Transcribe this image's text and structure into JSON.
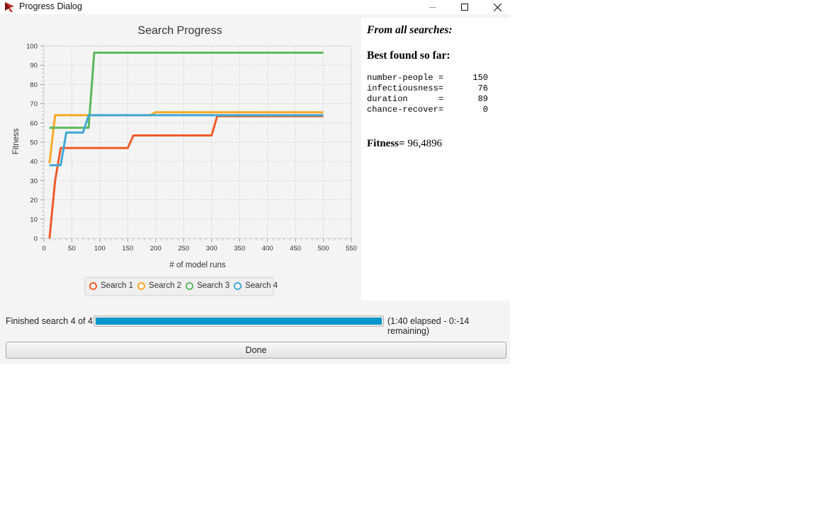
{
  "window": {
    "title": "Progress Dialog",
    "icon": "app-logo-icon",
    "controls": [
      "minimize-icon",
      "maximize-icon",
      "close-icon"
    ]
  },
  "chart_data": {
    "type": "line",
    "title": "Search Progress",
    "xlabel": "# of model runs",
    "ylabel": "Fitness",
    "xlim": [
      0,
      550
    ],
    "ylim": [
      0,
      100
    ],
    "xticks": [
      0,
      50,
      100,
      150,
      200,
      250,
      300,
      350,
      400,
      450,
      500,
      550
    ],
    "yticks": [
      0,
      10,
      20,
      30,
      40,
      50,
      60,
      70,
      80,
      90,
      100
    ],
    "grid": true,
    "legend": "bottom-center",
    "series": [
      {
        "name": "Search 1",
        "color": "#f05a28",
        "points": [
          [
            10,
            0
          ],
          [
            20,
            30
          ],
          [
            30,
            47
          ],
          [
            150,
            47
          ],
          [
            160,
            53.5
          ],
          [
            300,
            53.5
          ],
          [
            310,
            63.5
          ],
          [
            500,
            63.5
          ]
        ]
      },
      {
        "name": "Search 2",
        "color": "#f9a825",
        "points": [
          [
            10,
            39
          ],
          [
            20,
            64
          ],
          [
            190,
            64
          ],
          [
            200,
            65.5
          ],
          [
            500,
            65.5
          ]
        ]
      },
      {
        "name": "Search 3",
        "color": "#5cb85c",
        "points": [
          [
            10,
            57.5
          ],
          [
            80,
            57.5
          ],
          [
            90,
            96.5
          ],
          [
            500,
            96.5
          ]
        ]
      },
      {
        "name": "Search 4",
        "color": "#3fa9d6",
        "points": [
          [
            10,
            38
          ],
          [
            30,
            38
          ],
          [
            40,
            55
          ],
          [
            70,
            55
          ],
          [
            80,
            64
          ],
          [
            500,
            64
          ]
        ]
      }
    ]
  },
  "results": {
    "heading": "From all searches:",
    "best_heading": "Best found so far:",
    "params": [
      {
        "name": "number-people =",
        "value": "150"
      },
      {
        "name": "infectiousness=",
        "value": "76"
      },
      {
        "name": "duration      =",
        "value": "89"
      },
      {
        "name": "chance-recover=",
        "value": "0"
      }
    ],
    "fitness_label": "Fitness=",
    "fitness_value": " 96,4896"
  },
  "status": {
    "label": "Finished search 4 of 4:",
    "progress": 1.0,
    "elapsed": "(1:40 elapsed - 0:-14 remaining)"
  },
  "done_label": "Done"
}
